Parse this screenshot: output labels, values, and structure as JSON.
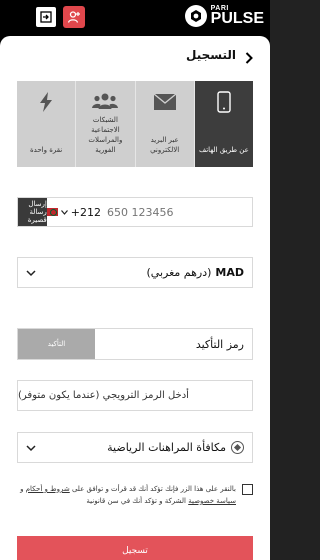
{
  "header": {
    "logo_pari": "PARI",
    "logo_pulse": "PULSE"
  },
  "page": {
    "title": "التسجيل"
  },
  "tabs": [
    {
      "label": "عن طريق الهاتف",
      "icon": "phone-icon",
      "active": true
    },
    {
      "label": "عبر البريد الالكتروني",
      "icon": "envelope-icon",
      "active": false
    },
    {
      "label": "الشبكات الاجتماعية والمراسلات الفورية",
      "icon": "people-icon",
      "active": false
    },
    {
      "label": "نقرة واحدة",
      "icon": "lightning-icon",
      "active": false
    }
  ],
  "phone": {
    "sms_button": "إرسال رسالة قصيرة",
    "country_code": "+212",
    "placeholder": "650 123456"
  },
  "currency": {
    "code": "MAD",
    "name": "(درهم مغربي)"
  },
  "captcha": {
    "button": "التأكيد",
    "label": "رمز التأكيد"
  },
  "promo": {
    "placeholder": "أدخل الرمز الترويجي (عندما يكون متوفر)"
  },
  "bonus": {
    "label": "مكافأة المراهنات الرياضية"
  },
  "terms": {
    "part1": "بالنقر على هذا الزر فإنك تؤكد أنك قد قرأت و توافق على ",
    "rules_link": "شروط و أحكام",
    "part2": " و ",
    "privacy_link": "سياسة خصوصية",
    "part3": " الشركة و تؤكد أنك في سن قانونية"
  },
  "submit_label": "تسجيل",
  "colors": {
    "accent": "#e3535a",
    "dark": "#3d3d3d",
    "tab_inactive": "#cfcfcf"
  }
}
